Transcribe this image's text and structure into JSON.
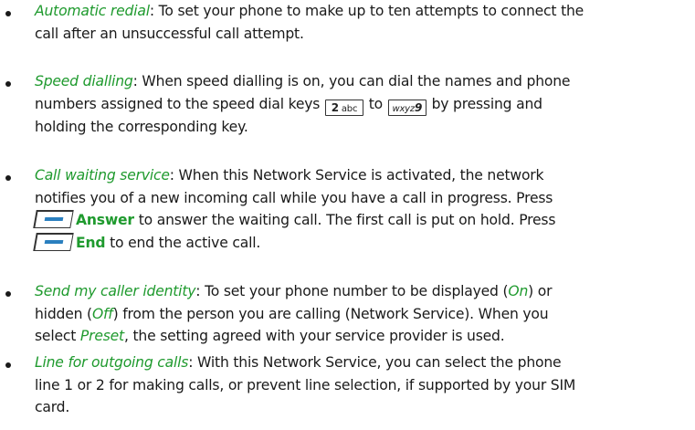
{
  "items": [
    {
      "term": "Automatic redial",
      "lines": [
        ": To set your phone to make up to ten attempts to connect the",
        "call after an unsuccessful call attempt."
      ]
    },
    {
      "term": "Speed dialling",
      "line1": ": When speed dialling is on, you can dial the names and phone",
      "line2_pre": "numbers assigned to the speed dial keys",
      "key_start_num": "2",
      "key_start_letters": "abc",
      "line2_mid": "to",
      "key_end_letters": "wxyz",
      "key_end_num": "9",
      "line2_post": "by pressing and",
      "line3": "holding the corresponding key."
    },
    {
      "term": "Call waiting service",
      "line1": ": When this Network Service is activated, the network",
      "line2": "notifies you of a new incoming call while you have a call in progress. Press",
      "answer_label": "Answer",
      "line3_post": "to answer the waiting call. The first call is put on hold. Press",
      "end_label": "End",
      "line4_post": "to end the active call."
    },
    {
      "term": "Send my caller identity",
      "line1_a": ": To set your phone number to be displayed (",
      "on_label": "On",
      "line1_b": ") or",
      "line2_a": "hidden (",
      "off_label": "Off",
      "line2_b": ") from the person you are calling (Network Service). When you",
      "line3_a": "select",
      "preset_label": "Preset",
      "line3_b": ", the setting agreed with your service provider is used."
    },
    {
      "term": "Line for outgoing calls",
      "line1": ": With this Network Service, you can select the phone",
      "line2": "line 1 or 2 for making calls, or prevent line selection, if supported by your SIM",
      "line3": "card."
    }
  ],
  "colors": {
    "term": "#1f9a2e",
    "text": "#1a1a1a",
    "selection_key": "#2a7fbf"
  },
  "icons": [
    "selection-key-icon",
    "key-2-icon",
    "key-9-icon",
    "bullet-icon"
  ]
}
